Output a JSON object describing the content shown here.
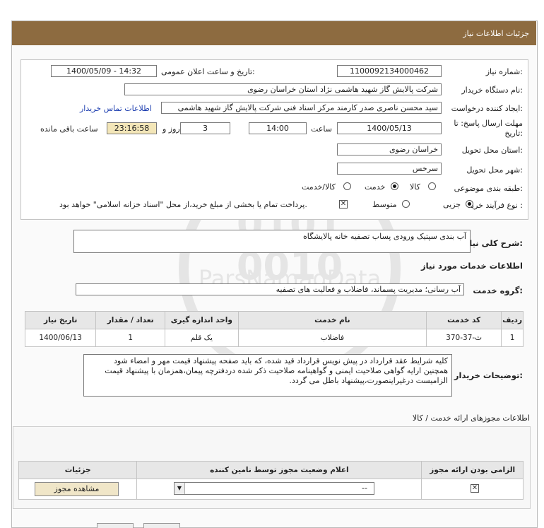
{
  "header": {
    "title": "جزئیات اطلاعات نیاز"
  },
  "fields": {
    "need_number_label": "شماره نیاز:",
    "need_number": "1100092134000462",
    "announce_label": "تاریخ و ساعت اعلان عمومی:",
    "announce_value": "1400/05/09 - 14:32",
    "buyer_org_label": "نام دستگاه خریدار:",
    "buyer_org": "شرکت پالایش گاز شهید هاشمی نژاد   استان خراسان رضوی",
    "requester_label": "ایجاد کننده درخواست:",
    "requester": "سید محسن  ناصری صدر کارمند مرکز اسناد فنی شرکت پالایش گاز شهید هاشمی",
    "contact_link": "اطلاعات تماس خریدار",
    "deadline_label": "مهلت ارسال پاسخ: تا تاریخ:",
    "deadline_date": "1400/05/13",
    "time_label": "ساعت",
    "deadline_time": "14:00",
    "days_value": "3",
    "days_label": "روز و",
    "remaining_time": "23:16:58",
    "remaining_label": "ساعت باقی مانده",
    "province_label": "استان محل تحویل:",
    "province": "خراسان رضوی",
    "city_label": "شهر محل تحویل:",
    "city": "سرخس",
    "category_label": "طبقه بندی موضوعی:",
    "category_options": [
      "کالا",
      "خدمت",
      "کالا/خدمت"
    ],
    "process_label": "نوع فرآیند خرید :",
    "process_options": [
      "جزیی",
      "متوسط"
    ],
    "payment_note": "پرداخت تمام یا بخشی از مبلغ خرید،از محل \"اسناد خزانه اسلامی\" خواهد بود."
  },
  "summary": {
    "label": "شرح کلی نیاز:",
    "value": "آب بندی سپتیک ورودی پساب تصفیه خانه پالایشگاه"
  },
  "services": {
    "section_title": "اطلاعات خدمات مورد نیاز",
    "group_label": "گروه خدمت:",
    "group_value": "آب رسانی؛ مدیریت پسماند، فاضلاب و فعالیت های تصفیه",
    "table_headers": [
      "ردیف",
      "کد خدمت",
      "نام خدمت",
      "واحد اندازه گیری",
      "تعداد / مقدار",
      "تاریخ نیاز"
    ],
    "rows": [
      [
        "1",
        "ث-37-370",
        "فاضلاب",
        "یک قلم",
        "1",
        "1400/06/13"
      ]
    ]
  },
  "buyer_notes": {
    "label": "توضیحات خریدار:",
    "text": "کلیه شرایط عقد قرارداد در پیش نویس قرارداد قید شده، که باید صفحه پیشنهاد قیمت مهر و امضاء شود همچنین ارایه گواهی صلاحیت ایمنی و گواهینامه صلاحیت ذکر شده دردفترچه پیمان،همزمان با پیشنهاد قیمت الزامیست درغیراینصورت،پیشنهاد باطل می گردد."
  },
  "permits": {
    "section_title": "اطلاعات مجوزهای ارائه خدمت / کالا",
    "headers": [
      "الزامی بودن ارائه مجوز",
      "اعلام وضعیت مجوز توسط نامین کننده",
      "جزئیات"
    ],
    "status_value": "--",
    "view_button": "مشاهده مجوز"
  },
  "watermark": {
    "text": "ParsNamadData"
  }
}
